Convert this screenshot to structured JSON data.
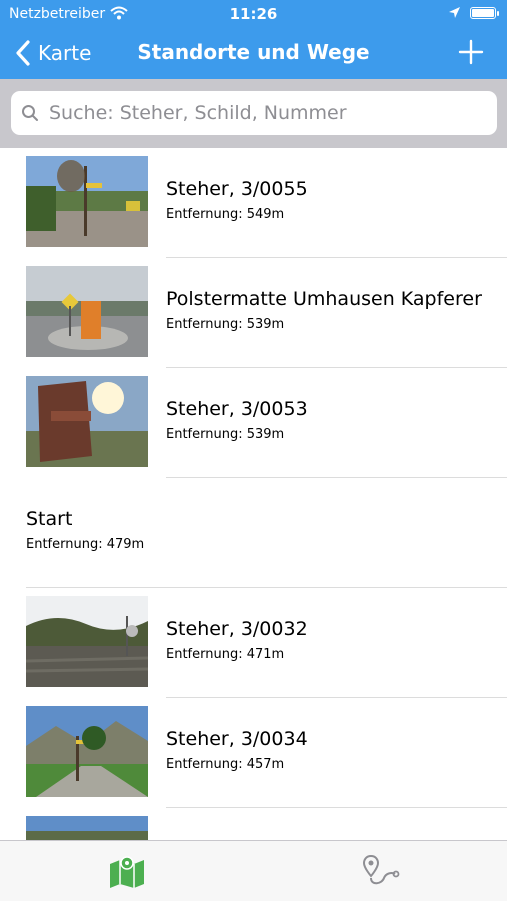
{
  "status_bar": {
    "carrier": "Netzbetreiber",
    "time": "11:26"
  },
  "navbar": {
    "back_label": "Karte",
    "title": "Standorte und Wege"
  },
  "search": {
    "placeholder": "Suche: Steher, Schild, Nummer",
    "value": ""
  },
  "list": {
    "items": [
      {
        "title": "Steher, 3/0055",
        "distance": "Entfernung: 549m"
      },
      {
        "title": "Polstermatte Umhausen Kapferer",
        "distance": "Entfernung: 539m"
      },
      {
        "title": "Steher, 3/0053",
        "distance": "Entfernung: 539m"
      },
      {
        "title": "Start",
        "distance": "Entfernung: 479m"
      },
      {
        "title": "Steher, 3/0032",
        "distance": "Entfernung: 471m"
      },
      {
        "title": "Steher, 3/0034",
        "distance": "Entfernung: 457m"
      }
    ]
  },
  "tabbar": {
    "tabs": [
      {
        "icon": "map-icon",
        "selected": true
      },
      {
        "icon": "route-icon",
        "selected": false
      }
    ]
  },
  "colors": {
    "accent": "#3d9bec",
    "tab_selected": "#4caf50",
    "tab_unselected": "#8e8e93"
  }
}
